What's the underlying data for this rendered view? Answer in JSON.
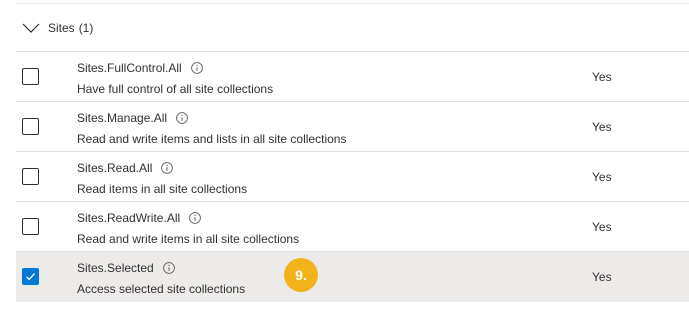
{
  "group": {
    "title": "Sites",
    "count": "(1)"
  },
  "rows": [
    {
      "name": "Sites.FullControl.All",
      "description": "Have full control of all site collections",
      "admin_consent": "Yes",
      "checked": false
    },
    {
      "name": "Sites.Manage.All",
      "description": "Read and write items and lists in all site collections",
      "admin_consent": "Yes",
      "checked": false
    },
    {
      "name": "Sites.Read.All",
      "description": "Read items in all site collections",
      "admin_consent": "Yes",
      "checked": false
    },
    {
      "name": "Sites.ReadWrite.All",
      "description": "Read and write items in all site collections",
      "admin_consent": "Yes",
      "checked": false
    },
    {
      "name": "Sites.Selected",
      "description": "Access selected site collections",
      "admin_consent": "Yes",
      "checked": true
    }
  ],
  "step_badge": "9.",
  "colors": {
    "accent": "#0078d4",
    "badge": "#f2b21c",
    "selected_row": "#edebe9"
  },
  "icons": {
    "group_toggle": "chevron-down-icon",
    "info": "info-icon",
    "check": "checkmark-icon"
  }
}
